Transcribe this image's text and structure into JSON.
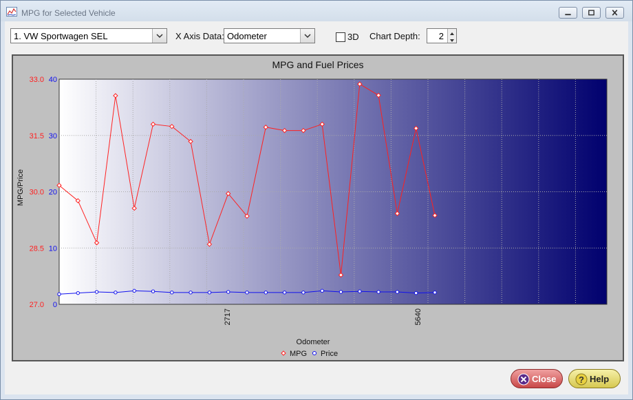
{
  "window": {
    "title": "MPG for Selected Vehicle"
  },
  "toolbar": {
    "vehicle_selected": "1. VW Sportwagen SEL",
    "x_axis_label": "X Axis Data:",
    "x_axis_selected": "Odometer",
    "three_d_label": "3D",
    "three_d_checked": false,
    "chart_depth_label": "Chart Depth:",
    "chart_depth_value": "2"
  },
  "buttons": {
    "close_label": "Close",
    "help_label": "Help"
  },
  "colors": {
    "mpg_series": "#ff2020",
    "price_series": "#1010ee",
    "plot_gradient_start": "#ffffff",
    "plot_gradient_end": "#00006e"
  },
  "chart_data": {
    "type": "line",
    "title": "MPG and Fuel Prices",
    "xlabel": "Odometer",
    "ylabel": "MPG/Price",
    "x_tick_labels": [
      "2717",
      "5640"
    ],
    "x": [
      0,
      1,
      2,
      3,
      4,
      5,
      6,
      7,
      8,
      9,
      10,
      11,
      12,
      13,
      14,
      15,
      16,
      17,
      18,
      19,
      20
    ],
    "y_left": {
      "range": [
        27.0,
        33.0
      ],
      "ticks": [
        "27.0",
        "28.5",
        "30.0",
        "31.5",
        "33.0"
      ],
      "color": "#ff2020"
    },
    "y_right": {
      "range": [
        0,
        40
      ],
      "ticks": [
        "0",
        "10",
        "20",
        "30",
        "40"
      ],
      "color": "#1010ee"
    },
    "grid": true,
    "legend_position": "bottom",
    "series": [
      {
        "name": "MPG",
        "axis": "left",
        "marker": "diamond",
        "values": [
          30.17,
          29.76,
          28.64,
          32.56,
          29.56,
          31.8,
          31.74,
          31.34,
          28.6,
          29.95,
          29.35,
          31.72,
          31.63,
          31.63,
          31.8,
          27.78,
          32.87,
          32.57,
          29.42,
          31.69,
          29.37
        ]
      },
      {
        "name": "Price",
        "axis": "right",
        "marker": "circle",
        "values": [
          1.8,
          2.0,
          2.2,
          2.1,
          2.4,
          2.3,
          2.1,
          2.1,
          2.1,
          2.2,
          2.1,
          2.1,
          2.1,
          2.1,
          2.4,
          2.2,
          2.3,
          2.2,
          2.2,
          2.0,
          2.1
        ]
      }
    ]
  }
}
